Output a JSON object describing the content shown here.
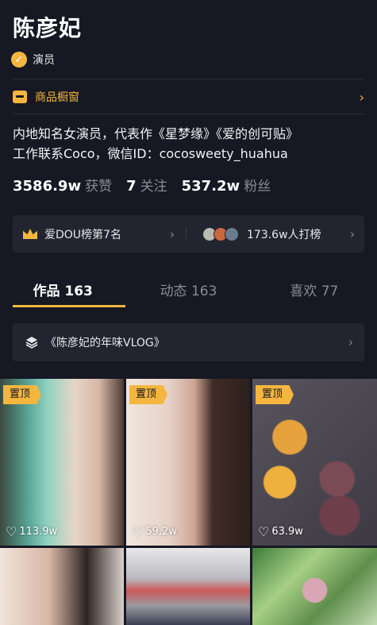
{
  "profile": {
    "name": "陈彦妃",
    "verified_label": "演员",
    "shop_label": "商品橱窗",
    "bio_line1": "内地知名女演员，代表作《星梦缘》《爱的创可贴》",
    "bio_line2": "工作联系Coco，微信ID：cocosweety_huahua"
  },
  "stats": {
    "likes_num": "3586.9w",
    "likes_label": "获赞",
    "following_num": "7",
    "following_label": "关注",
    "followers_num": "537.2w",
    "followers_label": "粉丝"
  },
  "rank": {
    "left_label": "爱DOU榜第7名",
    "right_label": "173.6w人打榜",
    "avatar_colors": [
      "#b9b9b0",
      "#c9673f",
      "#6a7d8e"
    ]
  },
  "tabs": [
    {
      "label": "作品 163"
    },
    {
      "label": "动态 163"
    },
    {
      "label": "喜欢 77"
    }
  ],
  "collection": {
    "label": "《陈彦妃的年味VLOG》"
  },
  "videos": [
    {
      "pin": "置顶",
      "likes": "113.9w"
    },
    {
      "pin": "置顶",
      "likes": "59.2w"
    },
    {
      "pin": "置顶",
      "likes": "63.9w"
    }
  ],
  "colors": {
    "background": "#161823",
    "accent": "#f4b63f",
    "card": "#222430",
    "muted": "#8a8b91"
  }
}
